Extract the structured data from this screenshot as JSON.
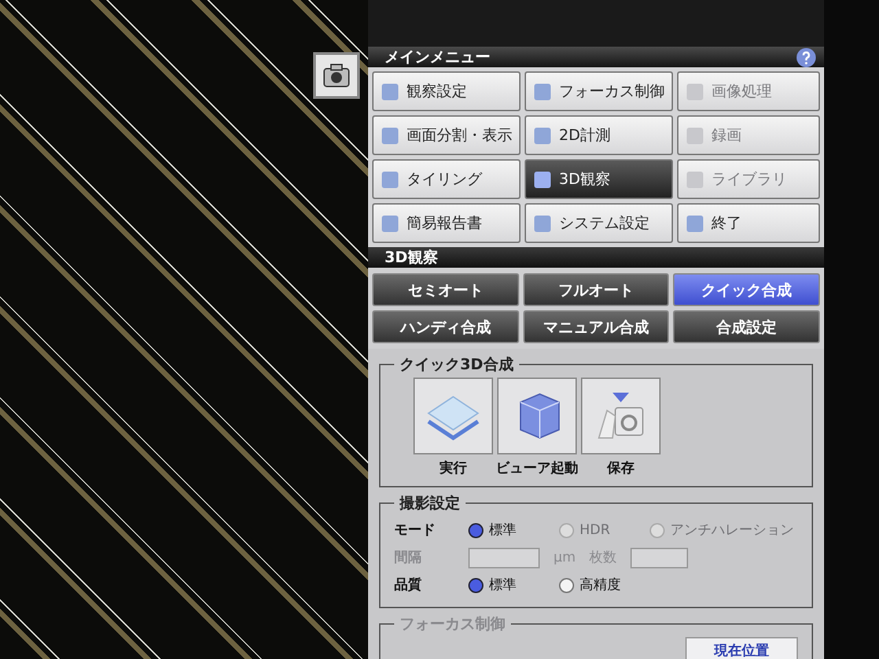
{
  "main_menu": {
    "title": "メインメニュー",
    "items": [
      {
        "label": "観察設定",
        "selected": false,
        "disabled": false
      },
      {
        "label": "フォーカス制御",
        "selected": false,
        "disabled": false
      },
      {
        "label": "画像処理",
        "selected": false,
        "disabled": true
      },
      {
        "label": "画面分割・表示",
        "selected": false,
        "disabled": false
      },
      {
        "label": "2D計測",
        "selected": false,
        "disabled": false
      },
      {
        "label": "録画",
        "selected": false,
        "disabled": true
      },
      {
        "label": "タイリング",
        "selected": false,
        "disabled": false
      },
      {
        "label": "3D観察",
        "selected": true,
        "disabled": false
      },
      {
        "label": "ライブラリ",
        "selected": false,
        "disabled": true
      },
      {
        "label": "簡易報告書",
        "selected": false,
        "disabled": false
      },
      {
        "label": "システム設定",
        "selected": false,
        "disabled": false
      },
      {
        "label": "終了",
        "selected": false,
        "disabled": false
      }
    ]
  },
  "sub_panel": {
    "title": "3D観察",
    "tabs": [
      {
        "label": "セミオート",
        "selected": false
      },
      {
        "label": "フルオート",
        "selected": false
      },
      {
        "label": "クイック合成",
        "selected": true
      },
      {
        "label": "ハンディ合成",
        "selected": false
      },
      {
        "label": "マニュアル合成",
        "selected": false
      },
      {
        "label": "合成設定",
        "selected": false
      }
    ]
  },
  "quick_3d": {
    "title": "クイック3D合成",
    "actions": [
      {
        "label": "実行",
        "kind": "layers"
      },
      {
        "label": "ビューア起動",
        "kind": "cube"
      },
      {
        "label": "保存",
        "kind": "camera"
      }
    ]
  },
  "capture_settings": {
    "title": "撮影設定",
    "mode": {
      "label": "モード",
      "options": [
        {
          "label": "標準",
          "selected": true,
          "disabled": false
        },
        {
          "label": "HDR",
          "selected": false,
          "disabled": true
        },
        {
          "label": "アンチハレーション",
          "selected": false,
          "disabled": true
        }
      ]
    },
    "interval": {
      "label": "間隔",
      "unit": "µm",
      "disabled": true
    },
    "count": {
      "label": "枚数",
      "disabled": true
    },
    "quality": {
      "label": "品質",
      "options": [
        {
          "label": "標準",
          "selected": true,
          "disabled": false
        },
        {
          "label": "高精度",
          "selected": false,
          "disabled": false
        }
      ]
    }
  },
  "focus_control": {
    "title": "フォーカス制御",
    "disabled": true,
    "button": "現在位置"
  }
}
